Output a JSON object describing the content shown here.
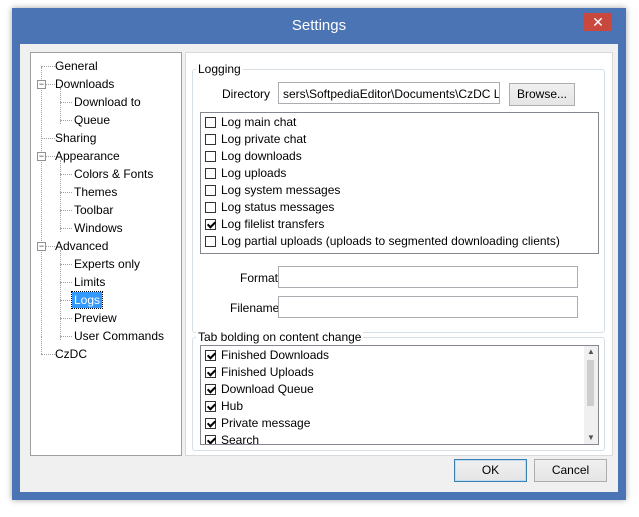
{
  "window": {
    "title": "Settings",
    "close_glyph": "✕"
  },
  "tree": {
    "items": [
      {
        "label": "General"
      },
      {
        "label": "Downloads"
      },
      {
        "label": "Download to"
      },
      {
        "label": "Queue"
      },
      {
        "label": "Sharing"
      },
      {
        "label": "Appearance"
      },
      {
        "label": "Colors & Fonts"
      },
      {
        "label": "Themes"
      },
      {
        "label": "Toolbar"
      },
      {
        "label": "Windows"
      },
      {
        "label": "Advanced"
      },
      {
        "label": "Experts only"
      },
      {
        "label": "Limits"
      },
      {
        "label": "Logs"
      },
      {
        "label": "Preview"
      },
      {
        "label": "User Commands"
      },
      {
        "label": "CzDC"
      }
    ],
    "selected": "Logs",
    "expander_glyph": "−"
  },
  "logging": {
    "group_title": "Logging",
    "directory_label": "Directory",
    "directory_value": "sers\\SoftpediaEditor\\Documents\\CzDC Logs\\",
    "browse_label": "Browse...",
    "options": [
      {
        "label": "Log main chat",
        "checked": false
      },
      {
        "label": "Log private chat",
        "checked": false
      },
      {
        "label": "Log downloads",
        "checked": false
      },
      {
        "label": "Log uploads",
        "checked": false
      },
      {
        "label": "Log system messages",
        "checked": false
      },
      {
        "label": "Log status messages",
        "checked": false
      },
      {
        "label": "Log filelist transfers",
        "checked": true
      },
      {
        "label": "Log partial uploads (uploads to segmented downloading clients)",
        "checked": false
      }
    ],
    "format_label": "Format",
    "format_value": "",
    "filename_label": "Filename",
    "filename_value": ""
  },
  "tab_bolding": {
    "group_title": "Tab bolding on content change",
    "options": [
      {
        "label": "Finished Downloads",
        "checked": true
      },
      {
        "label": "Finished Uploads",
        "checked": true
      },
      {
        "label": "Download Queue",
        "checked": true
      },
      {
        "label": "Hub",
        "checked": true
      },
      {
        "label": "Private message",
        "checked": true
      },
      {
        "label": "Search",
        "checked": true
      }
    ],
    "scroll_up_glyph": "▲",
    "scroll_down_glyph": "▼"
  },
  "buttons": {
    "ok_label": "OK",
    "cancel_label": "Cancel"
  }
}
